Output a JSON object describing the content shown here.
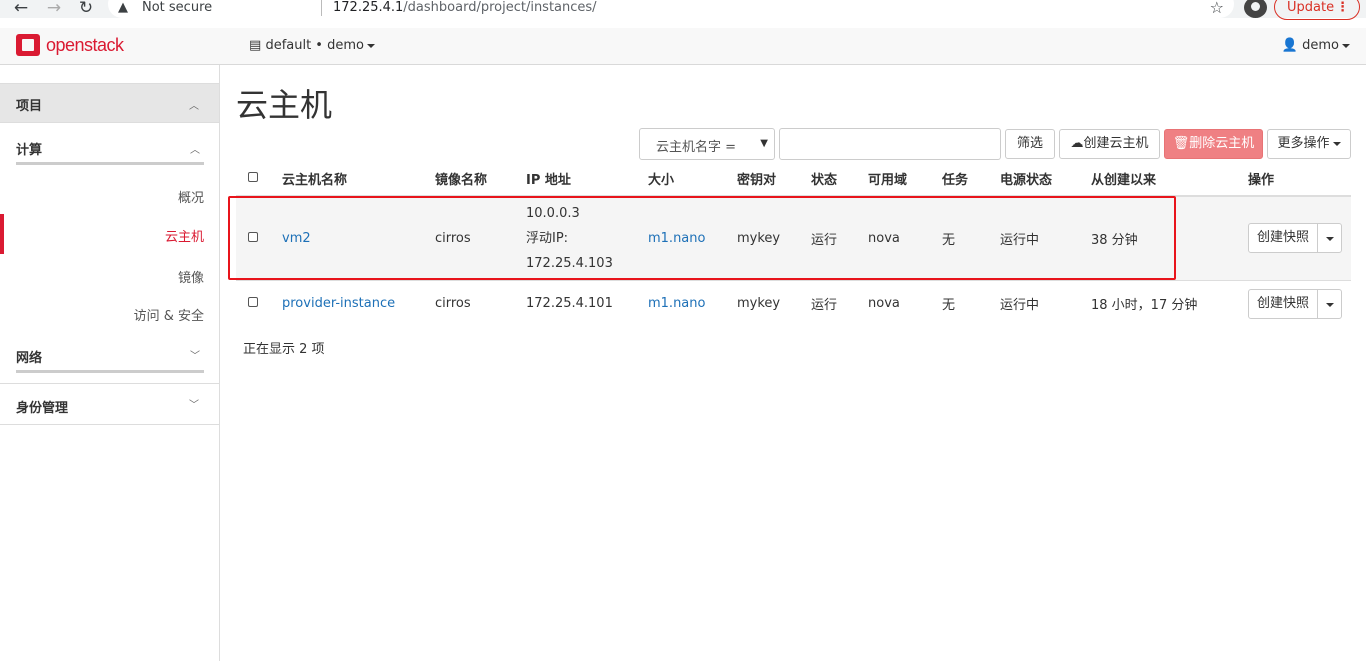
{
  "browser": {
    "security_label": "Not secure",
    "url_host": "172.25.4.1",
    "url_path": "/dashboard/project/instances/",
    "update_label": "Update"
  },
  "navbar": {
    "logo_text": "openstack",
    "project": "default • demo",
    "user": "demo"
  },
  "sidebar": {
    "project": "项目",
    "compute": "计算",
    "items": [
      "概况",
      "云主机",
      "镜像",
      "访问 & 安全"
    ],
    "network": "网络",
    "identity": "身份管理"
  },
  "main": {
    "title": "云主机",
    "filter_field": "云主机名字 =",
    "filter_button": "筛选",
    "create_button": "创建云主机",
    "delete_button": "删除云主机",
    "more_actions": "更多操作",
    "columns": [
      "云主机名称",
      "镜像名称",
      "IP 地址",
      "大小",
      "密钥对",
      "状态",
      "可用域",
      "任务",
      "电源状态",
      "从创建以来",
      "操作"
    ],
    "rows": [
      {
        "name": "vm2",
        "image": "cirros",
        "ip_lines": [
          "10.0.0.3",
          "浮动IP:",
          "172.25.4.103"
        ],
        "size": "m1.nano",
        "keypair": "mykey",
        "status": "运行",
        "zone": "nova",
        "task": "无",
        "power": "运行中",
        "age": "38 分钟",
        "action": "创建快照"
      },
      {
        "name": "provider-instance",
        "image": "cirros",
        "ip_lines": [
          "172.25.4.101"
        ],
        "size": "m1.nano",
        "keypair": "mykey",
        "status": "运行",
        "zone": "nova",
        "task": "无",
        "power": "运行中",
        "age": "18 小时，17 分钟",
        "action": "创建快照"
      }
    ],
    "count_text": "正在显示 2 项"
  },
  "colors": {
    "brand": "#da1a32",
    "link": "#1d70b7",
    "danger_button": "#ef8083",
    "highlight_box": "#e8141b"
  }
}
